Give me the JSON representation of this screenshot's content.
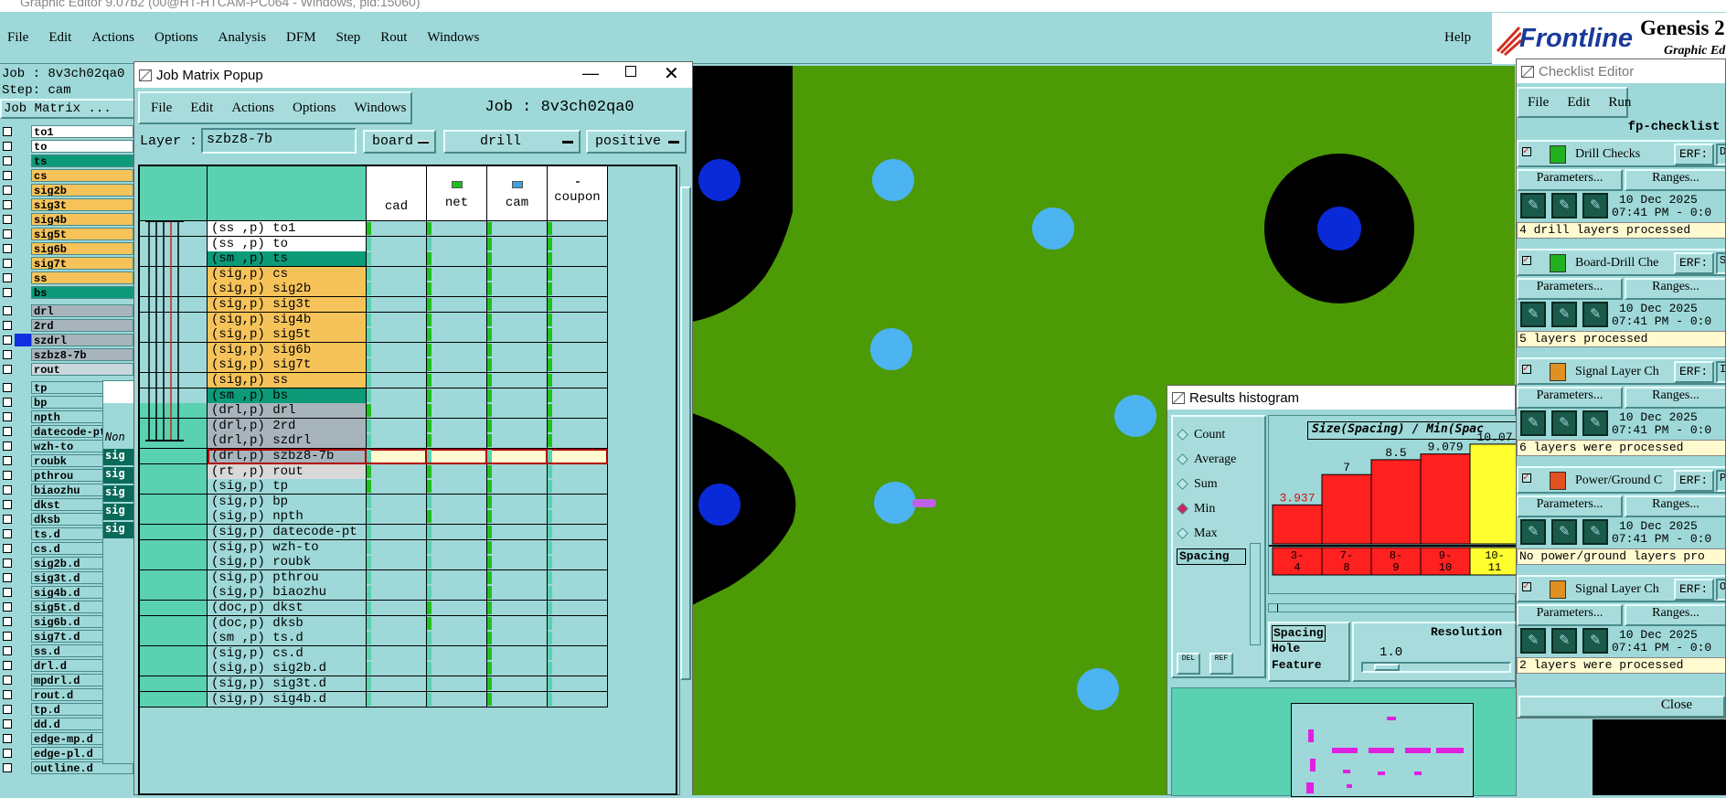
{
  "app": {
    "window_title": "Graphic Editor 9.07b2 (00@HT-HTCAM-PC064 - Windows, pid:15060)",
    "menus": [
      "File",
      "Edit",
      "Actions",
      "Options",
      "Analysis",
      "DFM",
      "Step",
      "Rout",
      "Windows"
    ],
    "help": "Help",
    "brand": "Frontline",
    "product": "Genesis 2",
    "product_sub": "Graphic Ed"
  },
  "left": {
    "job_label": "Job : 8v3ch02qa0",
    "step_label": "Step: cam",
    "job_matrix_btn": "Job Matrix ...",
    "layers1": [
      {
        "n": "to1",
        "c": "#ffffff"
      },
      {
        "n": "to",
        "c": "#ffffff"
      },
      {
        "n": "ts",
        "c": "#0d9a78"
      },
      {
        "n": "cs",
        "c": "#f6c35a"
      },
      {
        "n": "sig2b",
        "c": "#f6c35a"
      },
      {
        "n": "sig3t",
        "c": "#f6c35a"
      },
      {
        "n": "sig4b",
        "c": "#f6c35a"
      },
      {
        "n": "sig5t",
        "c": "#f6c35a"
      },
      {
        "n": "sig6b",
        "c": "#f6c35a"
      },
      {
        "n": "sig7t",
        "c": "#f6c35a"
      },
      {
        "n": "ss",
        "c": "#f6c35a"
      },
      {
        "n": "bs",
        "c": "#0d9a78"
      }
    ],
    "layers2": [
      {
        "n": "drl",
        "c": "#a8b4bc"
      },
      {
        "n": "2rd",
        "c": "#a8b4bc"
      },
      {
        "n": "szdrl",
        "c": "#a8b4bc"
      },
      {
        "n": "szbz8-7b",
        "c": "#a8b4bc"
      },
      {
        "n": "rout",
        "c": "#c8d8dc"
      }
    ],
    "layers3": [
      "tp",
      "bp",
      "npth",
      "datecode-pt",
      "wzh-to",
      "roubk",
      "pthrou",
      "biaozhu",
      "dkst",
      "dksb",
      "ts.d",
      "cs.d",
      "sig2b.d",
      "sig3t.d",
      "sig4b.d",
      "sig5t.d",
      "sig6b.d",
      "sig7t.d",
      "ss.d",
      "drl.d",
      "mpdrl.d",
      "rout.d",
      "tp.d",
      "dd.d",
      "edge-mp.d",
      "edge-pl.d",
      "outline.d"
    ],
    "bg_labels": [
      "Non",
      "sig",
      "sig",
      "sig",
      "sig",
      "sig"
    ]
  },
  "jm": {
    "title": "Job Matrix Popup",
    "menus": [
      "File",
      "Edit",
      "Actions",
      "Options",
      "Windows"
    ],
    "job": "Job : 8v3ch02qa0",
    "layer_label": "Layer :",
    "layer_value": "szbz8-7b",
    "ctx": "board",
    "type": "drill",
    "pol": "positive",
    "cols": [
      "cad",
      "net",
      "cam",
      "coupon"
    ],
    "rows": [
      {
        "t": "(ss ,p) to1",
        "c": "#ffffff"
      },
      {
        "t": "(ss ,p) to",
        "c": "#ffffff"
      },
      {
        "t": "(sm ,p) ts",
        "c": "#0d9a78"
      },
      {
        "t": "(sig,p) cs",
        "c": "#f6c35a"
      },
      {
        "t": "(sig,p) sig2b",
        "c": "#f6c35a"
      },
      {
        "t": "(sig,p) sig3t",
        "c": "#f6c35a"
      },
      {
        "t": "(sig,p) sig4b",
        "c": "#f6c35a"
      },
      {
        "t": "(sig,p) sig5t",
        "c": "#f6c35a"
      },
      {
        "t": "(sig,p) sig6b",
        "c": "#f6c35a"
      },
      {
        "t": "(sig,p) sig7t",
        "c": "#f6c35a"
      },
      {
        "t": "(sig,p) ss",
        "c": "#f6c35a"
      },
      {
        "t": "(sm ,p) bs",
        "c": "#0d9a78"
      },
      {
        "t": "(drl,p) drl",
        "c": "#a8b4bc"
      },
      {
        "t": "(drl,p) 2rd",
        "c": "#a8b4bc"
      },
      {
        "t": "(drl,p) szdrl",
        "c": "#a8b4bc"
      },
      {
        "t": "(drl,p) szbz8-7b",
        "c": "#a8b4bc"
      },
      {
        "t": "(rt ,p) rout",
        "c": "#d8d8d8"
      },
      {
        "t": "(sig,p) tp",
        "c": "#9ed8d8"
      },
      {
        "t": "(sig,p) bp",
        "c": "#9ed8d8"
      },
      {
        "t": "(sig,p) npth",
        "c": "#9ed8d8"
      },
      {
        "t": "(sig,p) datecode-pt",
        "c": "#9ed8d8"
      },
      {
        "t": "(sig,p) wzh-to",
        "c": "#9ed8d8"
      },
      {
        "t": "(sig,p) roubk",
        "c": "#9ed8d8"
      },
      {
        "t": "(sig,p) pthrou",
        "c": "#9ed8d8"
      },
      {
        "t": "(sig,p) biaozhu",
        "c": "#9ed8d8"
      },
      {
        "t": "(doc,p) dkst",
        "c": "#9ed8d8"
      },
      {
        "t": "(doc,p) dksb",
        "c": "#9ed8d8"
      },
      {
        "t": "(sm ,p) ts.d",
        "c": "#9ed8d8"
      },
      {
        "t": "(sig,p) cs.d",
        "c": "#9ed8d8"
      },
      {
        "t": "(sig,p) sig2b.d",
        "c": "#9ed8d8"
      },
      {
        "t": "(sig,p) sig3t.d",
        "c": "#9ed8d8"
      },
      {
        "t": "(sig,p) sig4b.d",
        "c": "#9ed8d8"
      }
    ]
  },
  "hist": {
    "title": "Results histogram",
    "opts": [
      "Count",
      "Average",
      "Sum",
      "Min",
      "Max"
    ],
    "selected": "Min",
    "list": [
      "Spacing"
    ],
    "chart_title": "Size(Spacing) / Min(Spac",
    "bins": [
      "3-4",
      "7-8",
      "8-9",
      "9-10",
      "10-11"
    ],
    "spacing_opts": [
      "Spacing",
      "Hole",
      "Feature"
    ],
    "resolution_label": "Resolution",
    "resolution_value": "1.0",
    "del": "DEL",
    "ref": "REF"
  },
  "chart_data": {
    "type": "bar",
    "categories": [
      "3-4",
      "7-8",
      "8-9",
      "9-10",
      "10-11"
    ],
    "values": [
      3.937,
      7,
      8.5,
      9.079,
      10.07
    ],
    "title": "Size(Spacing) / Min(Spac",
    "colors": [
      "#ff2020",
      "#ff2020",
      "#ff2020",
      "#ff2020",
      "#ffff30"
    ]
  },
  "cl": {
    "title": "Checklist Editor",
    "menus": [
      "File",
      "Edit",
      "Run"
    ],
    "name": "fp-checklist",
    "params": "Parameters...",
    "ranges": "Ranges...",
    "erf": "ERF:",
    "close": "Close",
    "items": [
      {
        "name": "Drill Checks",
        "erf": "D",
        "date": "10 Dec 2025",
        "time": "07:41 PM - 0:0",
        "status": "4 drill layers processed"
      },
      {
        "name": "Board-Drill Che",
        "erf": "S",
        "date": "10 Dec 2025",
        "time": "07:41 PM - 0:0",
        "status": "5 layers processed"
      },
      {
        "name": "Signal Layer Ch",
        "erf": "I",
        "date": "10 Dec 2025",
        "time": "07:41 PM - 0:0",
        "status": "6 layers were processed"
      },
      {
        "name": "Power/Ground C",
        "erf": "P",
        "date": "10 Dec 2025",
        "time": "07:41 PM - 0:0",
        "status": "No power/ground layers pro"
      },
      {
        "name": "Signal Layer Ch",
        "erf": "O",
        "date": "10 Dec 2025",
        "time": "07:41 PM - 0:0",
        "status": "2 layers were processed"
      }
    ]
  }
}
